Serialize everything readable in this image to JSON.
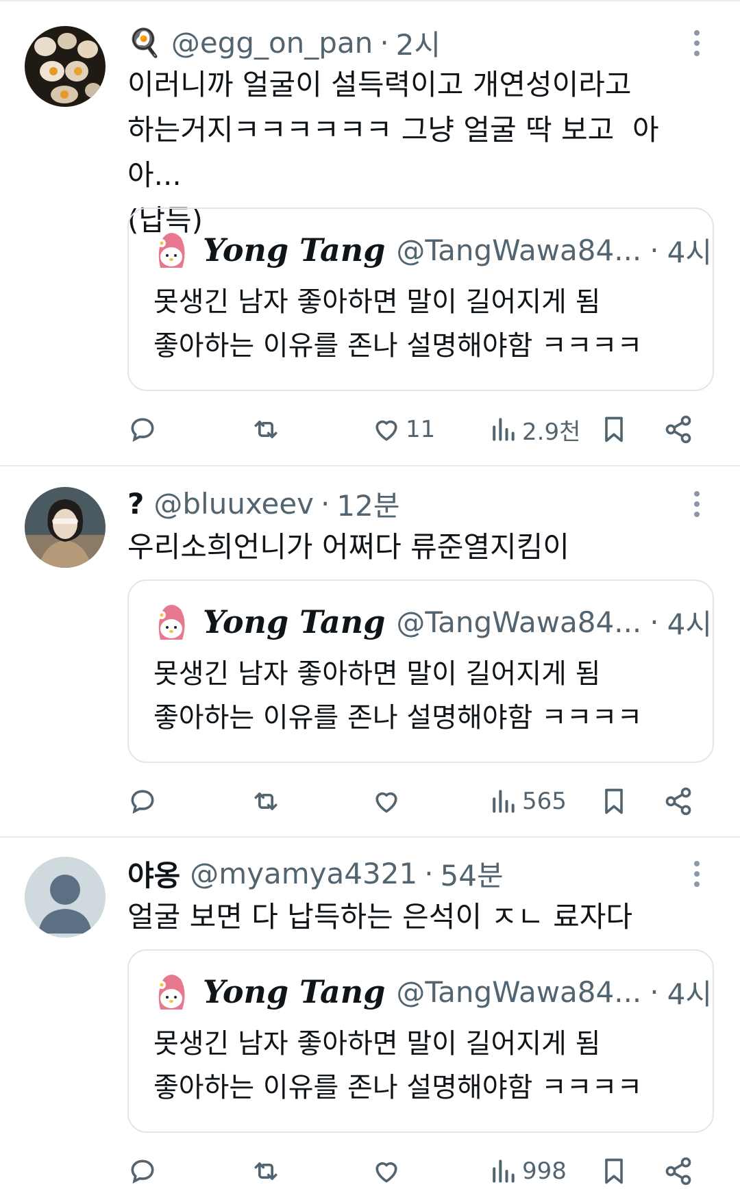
{
  "colors": {
    "text": "#0f1419",
    "muted": "#536471",
    "border": "#e1e5e9",
    "background": "#ffffff"
  },
  "tweets": [
    {
      "emoji": "🍳",
      "display_name": "",
      "handle": "@egg_on_pan",
      "separator": "·",
      "time": "2시",
      "text": "이러니까 얼굴이 설득력이고 개연성이라고\n하는거지ㅋㅋㅋㅋㅋㅋ 그냥 얼굴 딱 보고  아아...\n(납득)",
      "quote": {
        "name": "Yong Tang",
        "handle": "@TangWawa84...",
        "separator": "·",
        "time": "4시",
        "text": "못생긴 남자 좋아하면 말이 길어지게 됨\n좋아하는 이유를 존나 설명해야함 ㅋㅋㅋㅋ"
      },
      "stats": {
        "likes": "11",
        "views": "2.9천"
      }
    },
    {
      "emoji": "",
      "display_name": "?",
      "handle": "@bluuxeev",
      "separator": "·",
      "time": "12분",
      "text": "우리소희언니가 어쩌다 류준열지킴이",
      "quote": {
        "name": "Yong Tang",
        "handle": "@TangWawa84...",
        "separator": "·",
        "time": "4시",
        "text": "못생긴 남자 좋아하면 말이 길어지게 됨\n좋아하는 이유를 존나 설명해야함 ㅋㅋㅋㅋ"
      },
      "stats": {
        "likes": "",
        "views": "565"
      }
    },
    {
      "emoji": "",
      "display_name": "야옹",
      "handle": "@myamya4321",
      "separator": "·",
      "time": "54분",
      "text": "얼굴 보면 다 납득하는 은석이 ㅈㄴ 료자다",
      "quote": {
        "name": "Yong Tang",
        "handle": "@TangWawa84...",
        "separator": "·",
        "time": "4시",
        "text": "못생긴 남자 좋아하면 말이 길어지게 됨\n좋아하는 이유를 존나 설명해야함 ㅋㅋㅋㅋ"
      },
      "stats": {
        "likes": "",
        "views": "998"
      }
    }
  ],
  "icons": {
    "reply": "reply-icon",
    "retweet": "retweet-icon",
    "like": "heart-icon",
    "views": "views-icon",
    "bookmark": "bookmark-icon",
    "share": "share-icon",
    "more": "more-icon"
  }
}
